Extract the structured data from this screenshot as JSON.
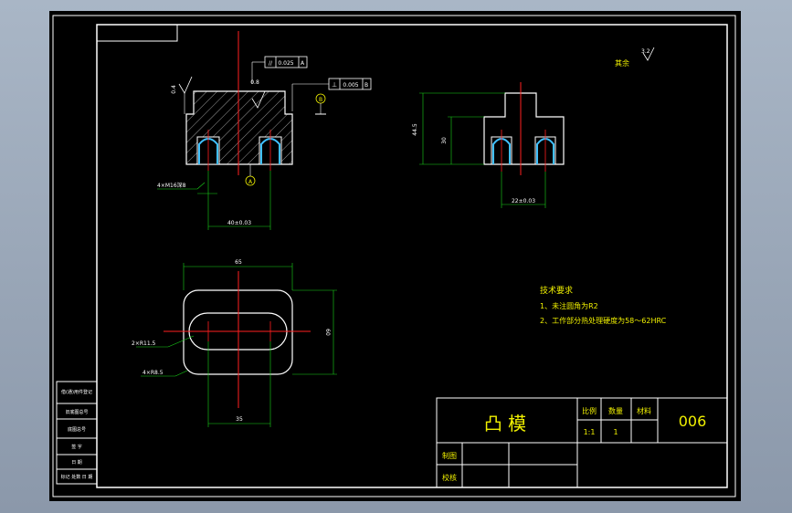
{
  "colors": {
    "background": "#000000",
    "frame": "#ffffff",
    "centerline": "#ff2020",
    "dimension": "#19d419",
    "hatch": "#ffffff",
    "text_yellow": "#f0f000",
    "text_green": "#19d419",
    "thread": "#40c0ff"
  },
  "front_view": {
    "gdt_parallel": {
      "symbol": "//",
      "tolerance": "0.025",
      "datum": "A"
    },
    "gdt_perp": {
      "symbol": "⊥",
      "tolerance": "0.005",
      "datum": "B"
    },
    "roughness_left": "0.4",
    "roughness_top": "0.8",
    "datum_b": "B",
    "datum_a": "A",
    "thread_label": "4×M16深8",
    "dim_bottom": "40±0.03"
  },
  "side_view": {
    "dim_height": "44.5",
    "dim_step": "30",
    "dim_bottom": "22±0.03",
    "other_roughness_label": "其余",
    "other_roughness_value": "3.2"
  },
  "top_view": {
    "dim_width": "65",
    "dim_height": "60",
    "dim_slot": "35",
    "slot_label": "2×R11.5",
    "corner_label": "4×R8.5"
  },
  "tech_requirements": {
    "title": "技术要求",
    "items": [
      "1、未注圆角为R2",
      "2、工作部分热处理硬度为58～62HRC"
    ]
  },
  "title_block": {
    "part_name": "凸  模",
    "scale_label": "比例",
    "scale_value": "1:1",
    "qty_label": "数量",
    "qty_value": "1",
    "material_label": "材料",
    "drawing_no": "006",
    "drawn_label": "制图",
    "checked_label": "校核"
  },
  "side_table": {
    "rows": [
      "借(通)用件登记",
      "旧底图总号",
      "底图总号",
      "签  字",
      "日  期"
    ],
    "footer": "标记 处数  日  期"
  }
}
